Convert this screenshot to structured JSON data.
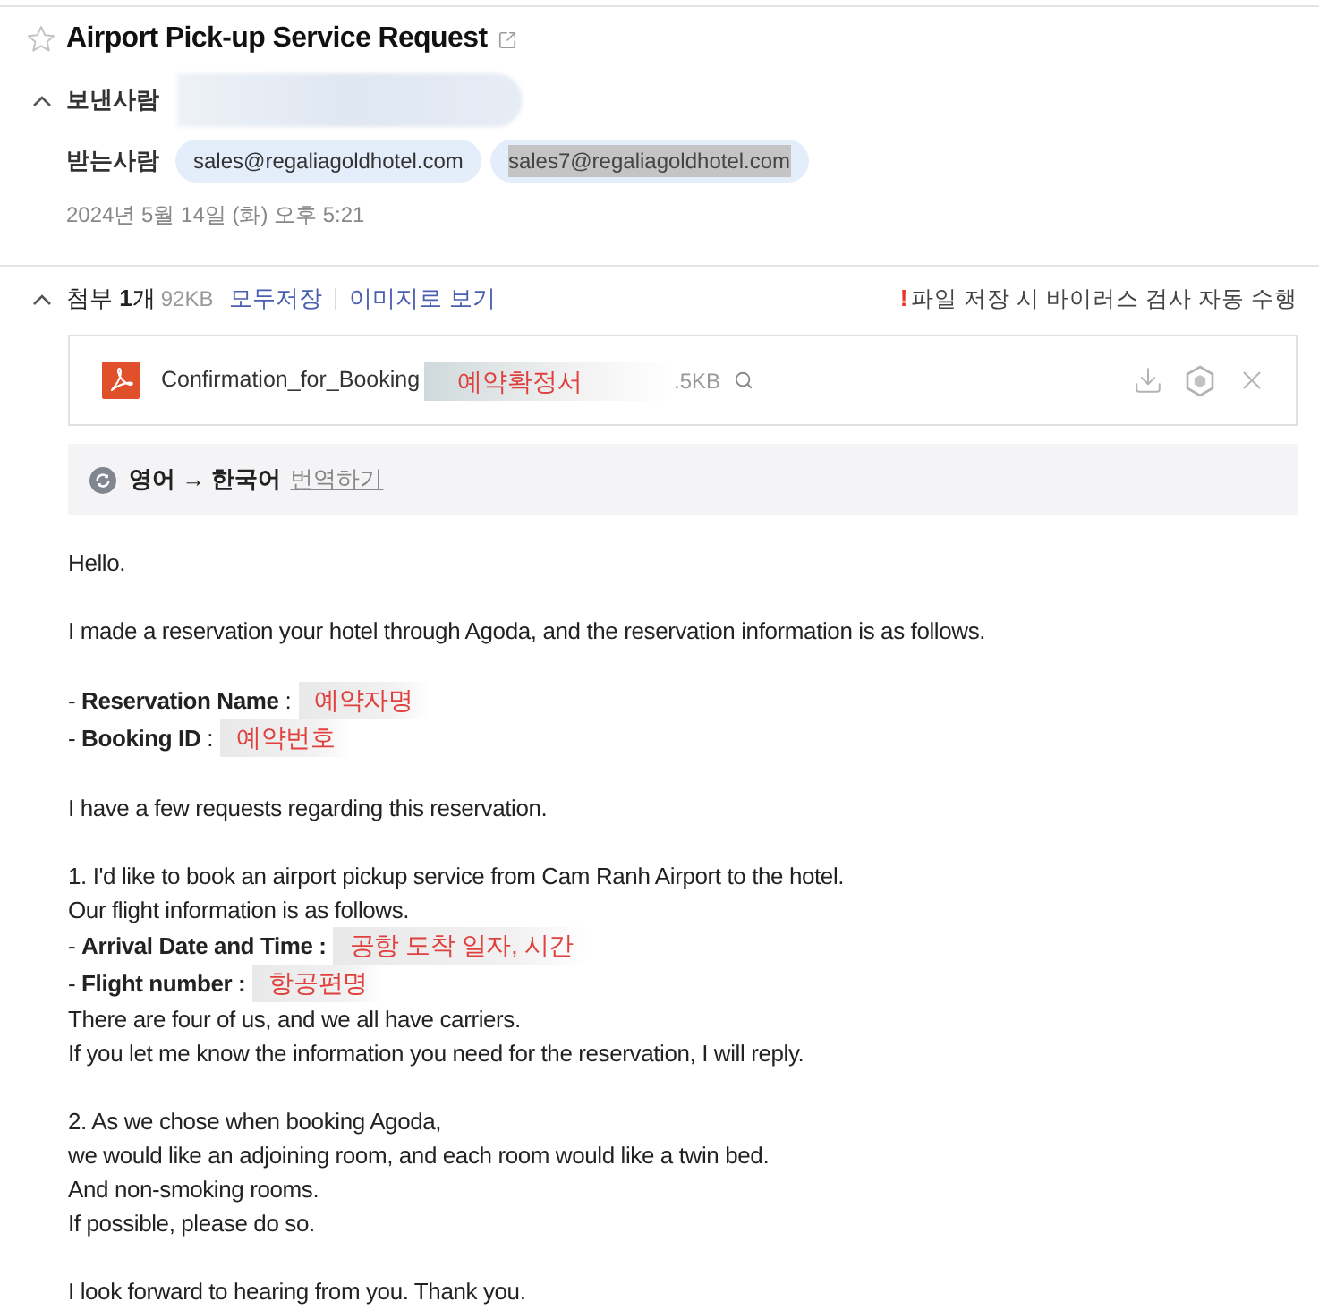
{
  "header": {
    "title": "Airport Pick-up Service Request",
    "starred": false
  },
  "sender": {
    "label": "보낸사람",
    "expanded": true,
    "redacted": true
  },
  "recipients": {
    "label": "받는사람",
    "items": [
      {
        "address": "sales@regaliagoldhotel.com",
        "text_selected": false
      },
      {
        "address": "sales7@regaliagoldhotel.com",
        "text_selected": true
      }
    ]
  },
  "date": "2024년 5월 14일 (화) 오후 5:21",
  "attachments": {
    "expanded": true,
    "count_label": "첨부 **1**개",
    "total_size": "92KB",
    "actions": [
      "모두저장",
      "이미지로 보기"
    ],
    "notice_mark": "!",
    "notice": "파일 저장 시 바이러스 검사 자동 수행",
    "files": [
      {
        "name": "Confirmation_for_Booking",
        "annotation": "예약확정서",
        "size": ".5KB"
      }
    ]
  },
  "translation": {
    "languages": "영어 → 한국어",
    "action": "번역하기"
  },
  "body": {
    "paragraphs": [
      {
        "lines": [
          {
            "kind": "text",
            "text": "Hello."
          }
        ]
      },
      {
        "lines": [
          {
            "kind": "text",
            "text": "I made a reservation your hotel through Agoda, and the reservation information is as follows."
          }
        ]
      },
      {
        "lines": [
          {
            "kind": "field",
            "text": "- **Reservation Name** :",
            "annotation": "예약자명"
          },
          {
            "kind": "field",
            "text": "- **Booking ID** :",
            "annotation": "예약번호"
          }
        ]
      },
      {
        "lines": [
          {
            "kind": "text",
            "text": "I have a few requests regarding this reservation."
          }
        ]
      },
      {
        "lines": [
          {
            "kind": "text",
            "text": "1. I'd like to book an airport pickup service from Cam Ranh Airport to the hotel."
          },
          {
            "kind": "text",
            "text": "Our flight information is as follows."
          },
          {
            "kind": "field",
            "text": "- **Arrival Date and Time :**",
            "annotation": "공항 도착 일자, 시간"
          },
          {
            "kind": "field",
            "text": "- **Flight number :**",
            "annotation": "항공편명"
          },
          {
            "kind": "text",
            "text": "There are four of us, and we all have carriers."
          },
          {
            "kind": "text",
            "text": "If you let me know the information you need for the reservation, I will reply."
          }
        ]
      },
      {
        "lines": [
          {
            "kind": "text",
            "text": "2. As we chose when booking Agoda,"
          },
          {
            "kind": "text",
            "text": "we would like an adjoining room, and each room would like a twin bed."
          },
          {
            "kind": "text",
            "text": "And non-smoking rooms."
          },
          {
            "kind": "text",
            "text": "If possible, please do so."
          }
        ]
      },
      {
        "lines": [
          {
            "kind": "text",
            "text": "I look forward to hearing from you. Thank you."
          }
        ]
      }
    ]
  }
}
